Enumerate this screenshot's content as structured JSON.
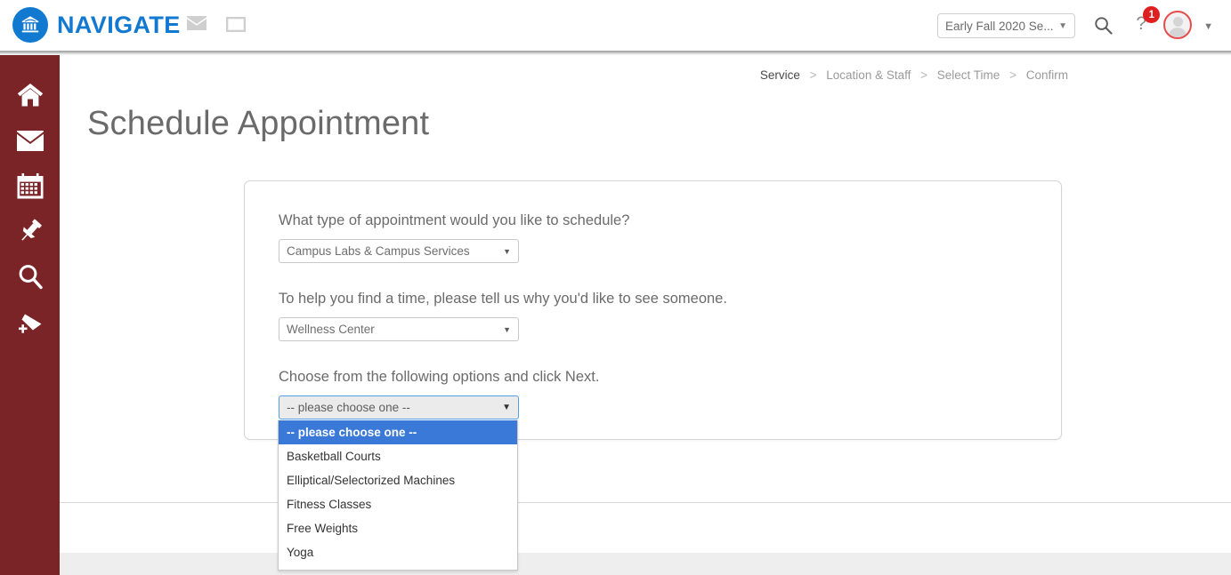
{
  "header": {
    "brand": "NAVIGATE",
    "logo_icon": "bank-building-icon",
    "mail_icon": "envelope-icon",
    "window_icon": "window-icon",
    "term_selector": {
      "value": "Early Fall 2020 Se...",
      "caret_icon": "chevron-down-icon"
    },
    "search_icon": "search-icon",
    "help_icon": "question-mark-icon",
    "notification_count": "1",
    "avatar_icon": "user-avatar-icon",
    "avatar_caret_icon": "chevron-down-icon",
    "brand_color": "#1179d0",
    "badge_color": "#e02020"
  },
  "sidebar": {
    "background_color": "#7b2428",
    "items": [
      {
        "name": "home",
        "icon": "home-icon"
      },
      {
        "name": "messages",
        "icon": "envelope-icon"
      },
      {
        "name": "calendar",
        "icon": "calendar-icon"
      },
      {
        "name": "pinned",
        "icon": "pushpin-icon"
      },
      {
        "name": "search",
        "icon": "magnifier-icon"
      },
      {
        "name": "add-to-list",
        "icon": "flag-plus-icon"
      }
    ]
  },
  "breadcrumb": {
    "current": "Service",
    "sep": ">",
    "steps": [
      "Location & Staff",
      "Select Time",
      "Confirm"
    ]
  },
  "page": {
    "title": "Schedule Appointment"
  },
  "form": {
    "questions": [
      {
        "label": "What type of appointment would you like to schedule?",
        "select_value": "Campus Labs & Campus Services",
        "caret_icon": "chevron-down-icon"
      },
      {
        "label": "To help you find a time, please tell us why you'd like to see someone.",
        "select_value": "Wellness Center",
        "caret_icon": "chevron-down-icon"
      },
      {
        "label": "Choose from the following options and click Next.",
        "select_value": "-- please choose one --",
        "caret_icon": "chevron-down-icon"
      }
    ],
    "open_dropdown": {
      "highlight_color": "#3b79d8",
      "options": [
        "-- please choose one --",
        "Basketball Courts",
        "Elliptical/Selectorized Machines",
        "Fitness Classes",
        "Free Weights",
        "Yoga"
      ],
      "selected_index": 0
    }
  }
}
